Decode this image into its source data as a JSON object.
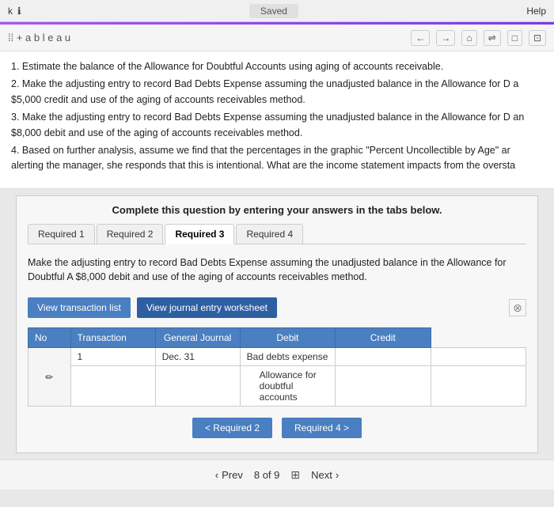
{
  "topbar": {
    "left_label": "k",
    "info_icon": "ℹ",
    "center_label": "Saved",
    "right_label": "Help"
  },
  "tableau": {
    "logo": "⁞⁞ + a b l e a u",
    "nav_back": "←",
    "nav_forward": "→",
    "nav_home": "⌂",
    "nav_share": "⇌",
    "nav_comment": "□",
    "nav_fullscreen": "⊡"
  },
  "instructions": [
    "1. Estimate the balance of the Allowance for Doubtful Accounts using aging of accounts receivable.",
    "2. Make the adjusting entry to record Bad Debts Expense assuming the unadjusted balance in the Allowance for D a $5,000 credit and use of the aging of accounts receivables method.",
    "3. Make the adjusting entry to record Bad Debts Expense assuming the unadjusted balance in the Allowance for D an $8,000 debit and use of the aging of accounts receivables method.",
    "4. Based on further analysis, assume we find that the percentages in the graphic \"Percent Uncollectible by Age\" ar alerting the manager, she responds that this is intentional. What are the income statement impacts from the oversta"
  ],
  "question_header": "Complete this question by entering your answers in the tabs below.",
  "tabs": [
    {
      "id": "req1",
      "label": "Required 1"
    },
    {
      "id": "req2",
      "label": "Required 2"
    },
    {
      "id": "req3",
      "label": "Required 3",
      "active": true
    },
    {
      "id": "req4",
      "label": "Required 4"
    }
  ],
  "tab_content": "Make the adjusting entry to record Bad Debts Expense assuming the unadjusted balance in the Allowance for Doubtful A $8,000 debit and use of the aging of accounts receivables method.",
  "buttons": {
    "view_transaction": "View transaction list",
    "view_journal": "View journal entry worksheet"
  },
  "table": {
    "headers": [
      "No",
      "Transaction",
      "General Journal",
      "Debit",
      "Credit"
    ],
    "rows": [
      {
        "icon": "✏",
        "no": "1",
        "transaction": "Dec. 31",
        "journal_entries": [
          "Bad debts expense",
          "Allowance for doubtful accounts"
        ],
        "debit": "",
        "credit": ""
      }
    ]
  },
  "nav_buttons": {
    "prev_label": "< Required 2",
    "next_label": "Required 4 >"
  },
  "pagination": {
    "prev": "< Prev",
    "page_info": "8 of 9",
    "next": "Next >"
  }
}
